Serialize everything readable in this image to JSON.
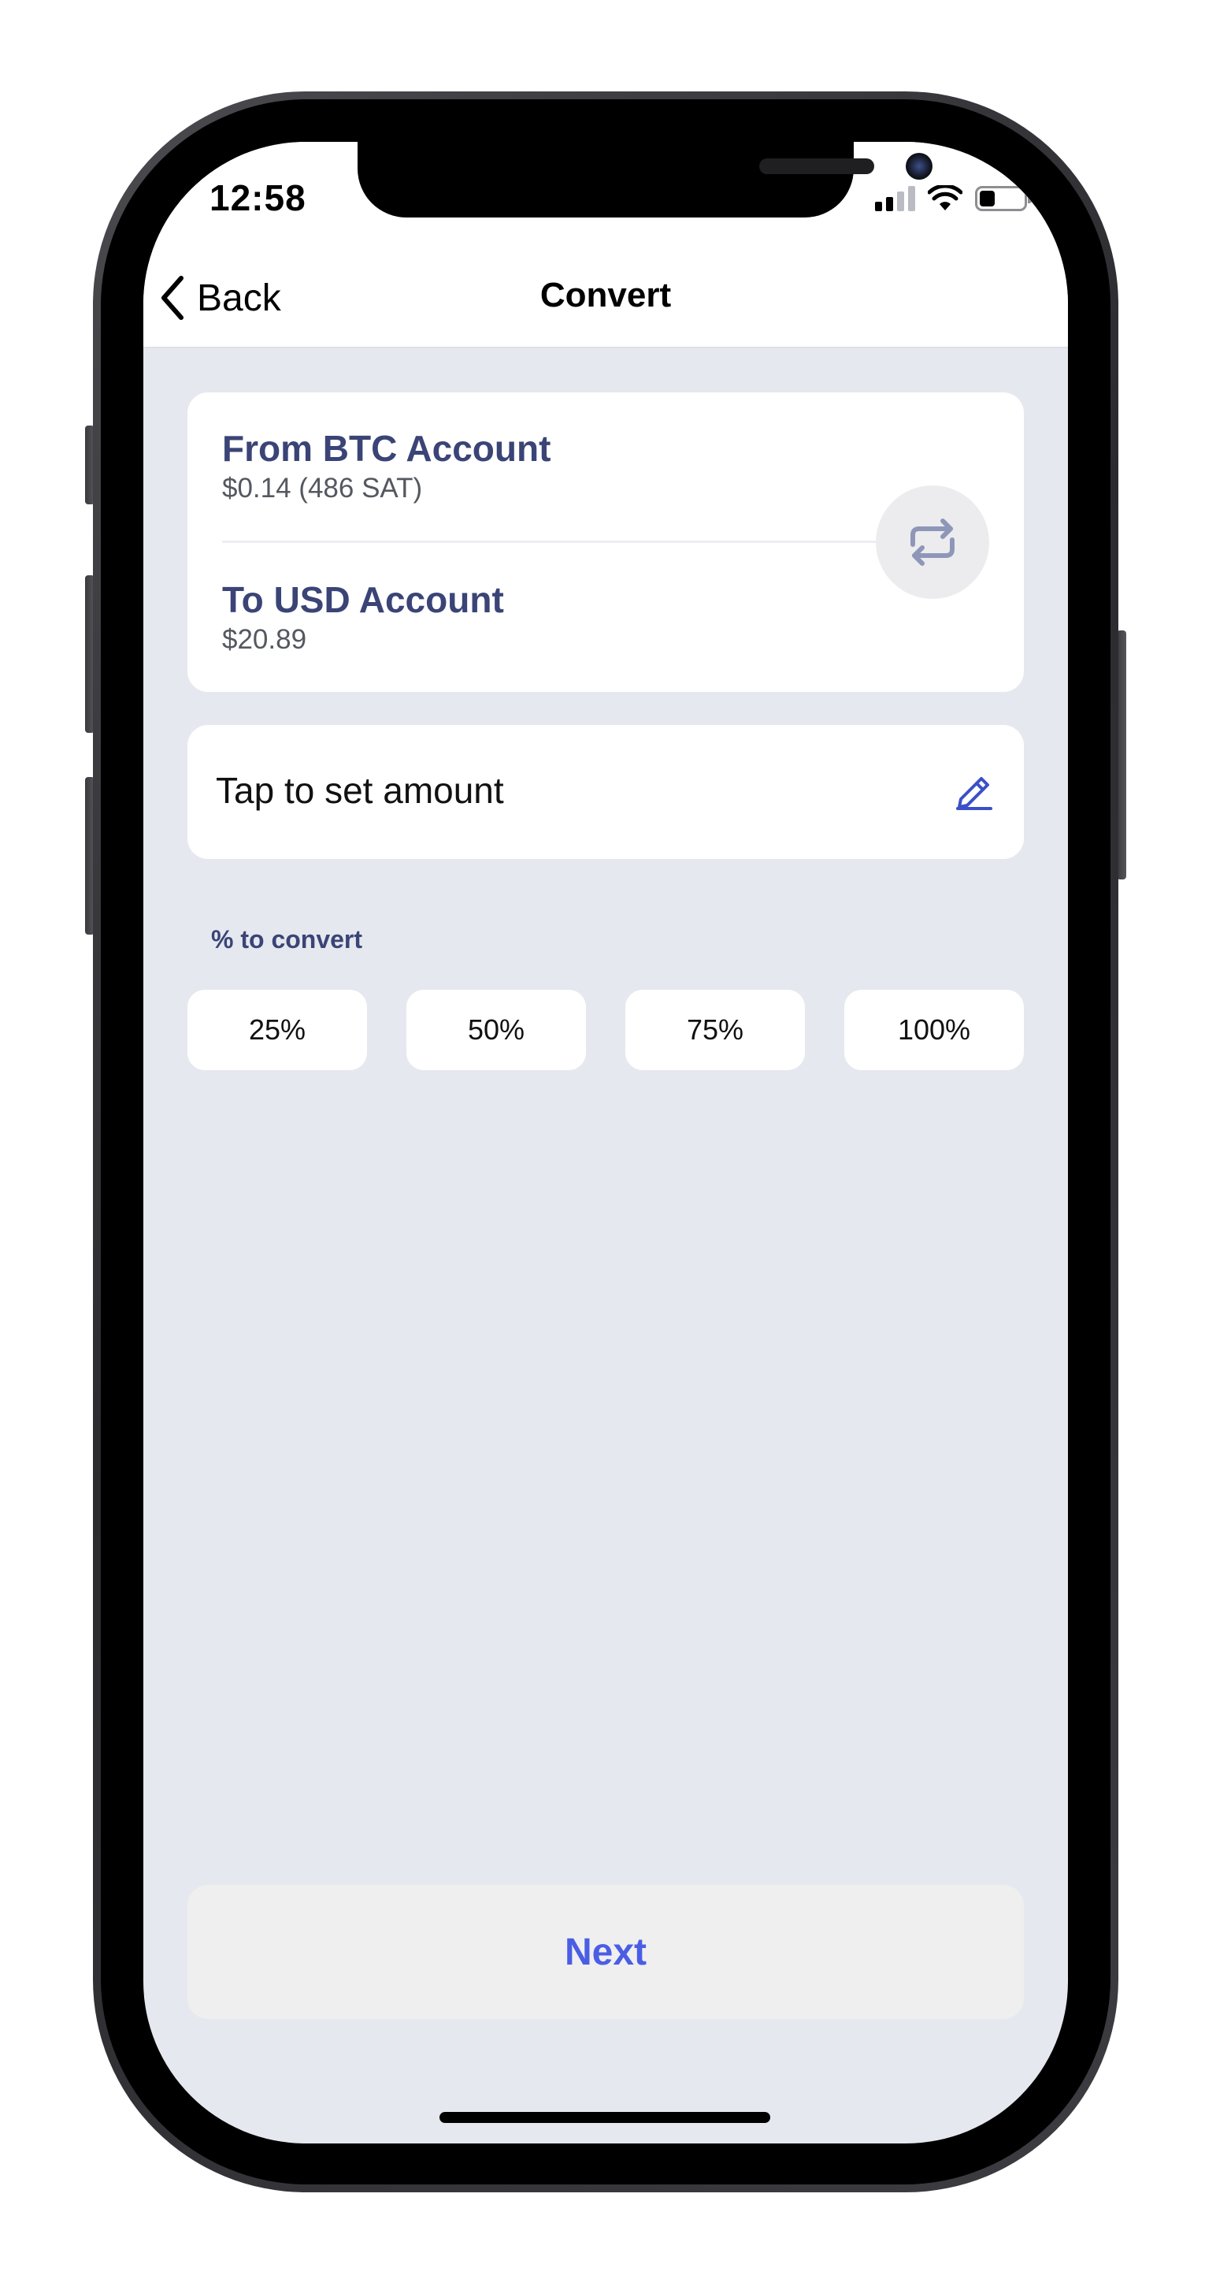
{
  "status_bar": {
    "time": "12:58",
    "signal_bars_active": 2,
    "signal_bars_total": 4,
    "battery_level": 0.35,
    "icons": [
      "signal-icon",
      "wifi-icon",
      "battery-icon"
    ]
  },
  "nav": {
    "back_label": "Back",
    "title": "Convert"
  },
  "accounts": {
    "from_title": "From BTC Account",
    "from_balance": "$0.14 (486 SAT)",
    "to_title": "To USD Account",
    "to_balance": "$20.89",
    "swap_icon": "swap-arrows-icon"
  },
  "amount": {
    "placeholder": "Tap to set amount",
    "edit_icon": "pencil-icon"
  },
  "percent": {
    "heading": "% to convert",
    "options": [
      "25%",
      "50%",
      "75%",
      "100%"
    ]
  },
  "actions": {
    "next_label": "Next"
  },
  "colors": {
    "account_title": "#3a4476",
    "accent": "#4a5ee4",
    "screen_background": "#e5e8ee",
    "card_background": "#ffffff",
    "swap_icon": "#8e97b8"
  }
}
